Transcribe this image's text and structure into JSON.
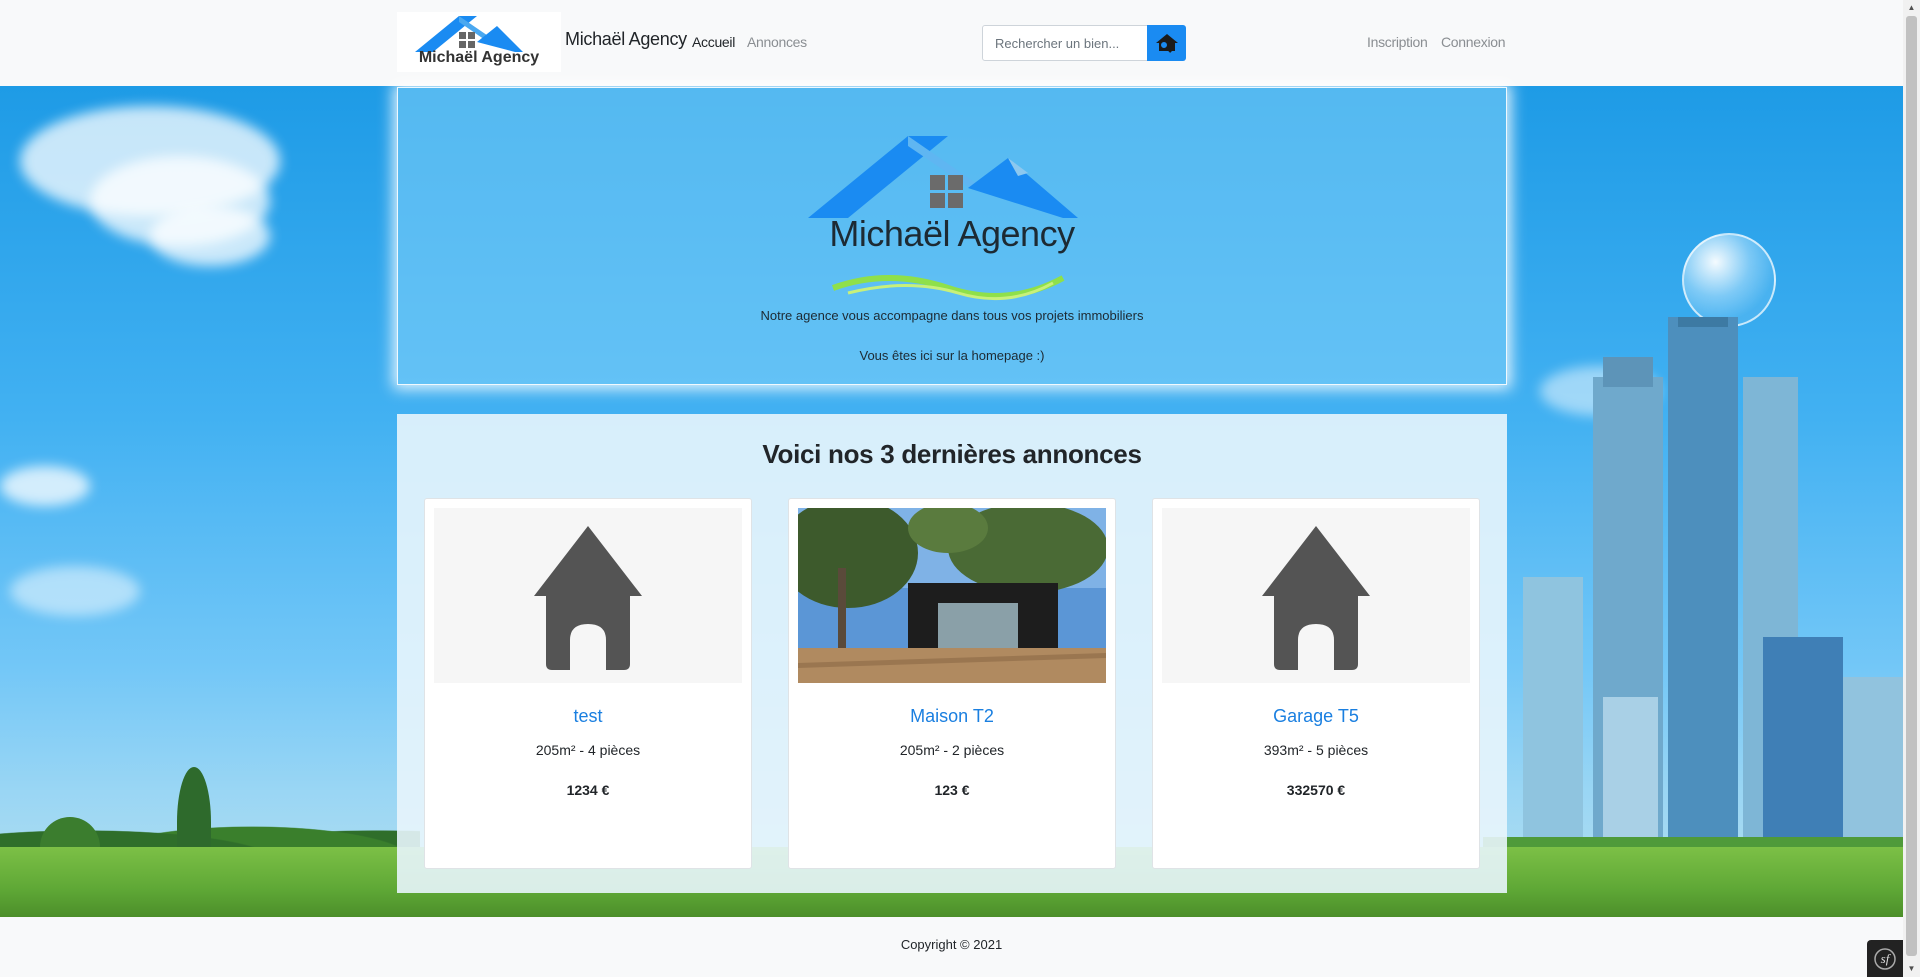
{
  "navbar": {
    "logo_text": "Michaël Agency",
    "brand_name": "Michaël Agency",
    "links": {
      "accueil": "Accueil",
      "annonces": "Annonces",
      "inscription": "Inscription",
      "connexion": "Connexion"
    },
    "search": {
      "placeholder": "Rechercher un bien...",
      "value": ""
    }
  },
  "hero": {
    "logo_title": "Michaël Agency",
    "tagline": "Notre agence vous accompagne dans tous vos projets immobiliers",
    "subtitle": "Vous êtes ici sur la homepage :)"
  },
  "listings": {
    "title": "Voici nos 3 dernières annonces",
    "cards": [
      {
        "title": "test",
        "meta": "205m² - 4 pièces",
        "price": "1234 €",
        "image": "placeholder-house-icon"
      },
      {
        "title": "Maison T2",
        "meta": "205m² - 2 pièces",
        "price": "123 €",
        "image": "modern-house-photo"
      },
      {
        "title": "Garage T5",
        "meta": "393m² - 5 pièces",
        "price": "332570 €",
        "image": "placeholder-house-icon"
      }
    ]
  },
  "footer": {
    "copyright": "Copyright © 2021"
  },
  "colors": {
    "accent": "#1a8bf2",
    "link": "#1a7fe0",
    "sky": "#42b1f2"
  }
}
